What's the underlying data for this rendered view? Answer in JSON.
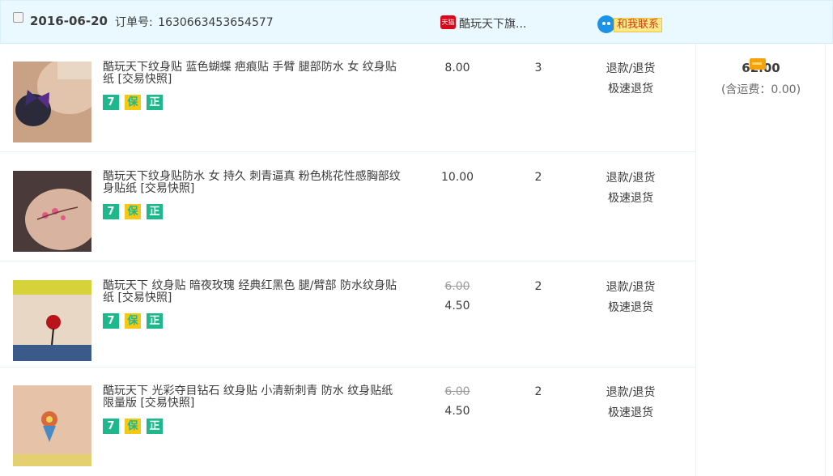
{
  "order": {
    "date": "2016-06-20",
    "order_no_label": "订单号:",
    "order_no": "1630663453654577",
    "shop_badge": "天猫",
    "shop_name": "酷玩天下旗...",
    "contact_label": "和我联系"
  },
  "items": [
    {
      "title": "酷玩天下纹身贴 蓝色蝴蝶 疤痕贴 手臂 腿部防水 女 纹身贴纸 [交易快照]",
      "old_price": "",
      "price": "8.00",
      "qty": "3",
      "refund": "退款/退货",
      "fast_refund": "极速退货"
    },
    {
      "title": "酷玩天下纹身贴防水 女 持久 刺青逼真 粉色桃花性感胸部纹身贴纸 [交易快照]",
      "old_price": "",
      "price": "10.00",
      "qty": "2",
      "refund": "退款/退货",
      "fast_refund": "极速退货"
    },
    {
      "title": "酷玩天下 纹身贴 暗夜玫瑰 经典红黑色 腿/臂部 防水纹身贴纸 [交易快照]",
      "old_price": "6.00",
      "price": "4.50",
      "qty": "2",
      "refund": "退款/退货",
      "fast_refund": "极速退货"
    },
    {
      "title": "酷玩天下 光彩夺目钻石 纹身贴 小清新刺青 防水 纹身贴纸 限量版 [交易快照]",
      "old_price": "6.00",
      "price": "4.50",
      "qty": "2",
      "refund": "退款/退货",
      "fast_refund": "极速退货"
    }
  ],
  "badges": {
    "seven_day": "7",
    "mid_icon": "保",
    "genuine": "正"
  },
  "summary": {
    "total": "62.00",
    "shipping": "(含运费：0.00)"
  },
  "icons": {
    "shop": "tmall-icon",
    "contact": "wangwang-chat-icon",
    "payment": "payment-card-icon"
  },
  "colors": {
    "header_bg": "#eaf8ff",
    "badge_green": "#1fb88c",
    "tmall_red": "#d8091a",
    "contact_blue": "#1c93e8"
  }
}
